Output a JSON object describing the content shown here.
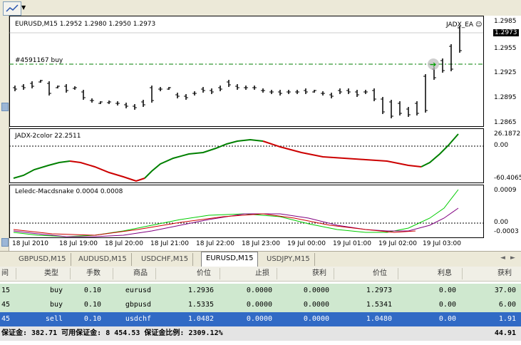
{
  "chart": {
    "header": "EURUSD,M15  1.2952 1.2980 1.2950 1.2973",
    "ea_label": "JADX_EA",
    "ea_smiley": "☺",
    "order_label": "#4591167 buy",
    "current_price": "1.2973",
    "price_ticks": [
      "1.2985",
      "1.2955",
      "1.2925",
      "1.2895",
      "1.2865"
    ],
    "ind1_label": "JADX-2color 22.2511",
    "ind1_ticks": [
      "26.1872",
      "0.00",
      "-60.4065"
    ],
    "ind2_label": "Leledc-Macdsnake 0.0004 0.0008",
    "ind2_ticks": [
      "0.0009",
      "0.00",
      "-0.0003"
    ],
    "time_ticks": [
      "18 Jul 2010",
      "18 Jul 19:00",
      "18 Jul 20:00",
      "18 Jul 21:00",
      "18 Jul 22:00",
      "18 Jul 23:00",
      "19 Jul 00:00",
      "19 Jul 01:00",
      "19 Jul 02:00",
      "19 Jul 03:00"
    ],
    "colors": {
      "bull": "#008000",
      "bear": "#cc0000",
      "macd_main": "#00cc00",
      "macd_signal": "#800080",
      "macd_hist": "#cc0000",
      "order_line": "#008000"
    }
  },
  "tabs": [
    "GBPUSD,M15",
    "AUDUSD,M15",
    "USDCHF,M15",
    "EURUSD,M15",
    "USDJPY,M15"
  ],
  "active_tab": "EURUSD,M15",
  "tab_nav": {
    "left": "◄",
    "right": "►"
  },
  "terminal": {
    "headers": [
      "间",
      "类型",
      "手数",
      "商品",
      "价位",
      "止损",
      "获利",
      "价位",
      "利息",
      "获利"
    ],
    "rows": [
      {
        "id": "15",
        "type": "buy",
        "lots": "0.10",
        "symbol": "eurusd",
        "price": "1.2936",
        "sl": "0.0000",
        "tp": "0.0000",
        "cur": "1.2973",
        "swap": "0.00",
        "profit": "37.00"
      },
      {
        "id": "45",
        "type": "buy",
        "lots": "0.10",
        "symbol": "gbpusd",
        "price": "1.5335",
        "sl": "0.0000",
        "tp": "0.0000",
        "cur": "1.5341",
        "swap": "0.00",
        "profit": "6.00"
      },
      {
        "id": "45",
        "type": "sell",
        "lots": "0.10",
        "symbol": "usdchf",
        "price": "1.0482",
        "sl": "0.0000",
        "tp": "0.0000",
        "cur": "1.0480",
        "swap": "0.00",
        "profit": "1.91"
      }
    ],
    "summary": "保证金: 382.71  可用保证金: 8 454.53  保证金比例: 2309.12%",
    "total_profit": "44.91"
  }
}
